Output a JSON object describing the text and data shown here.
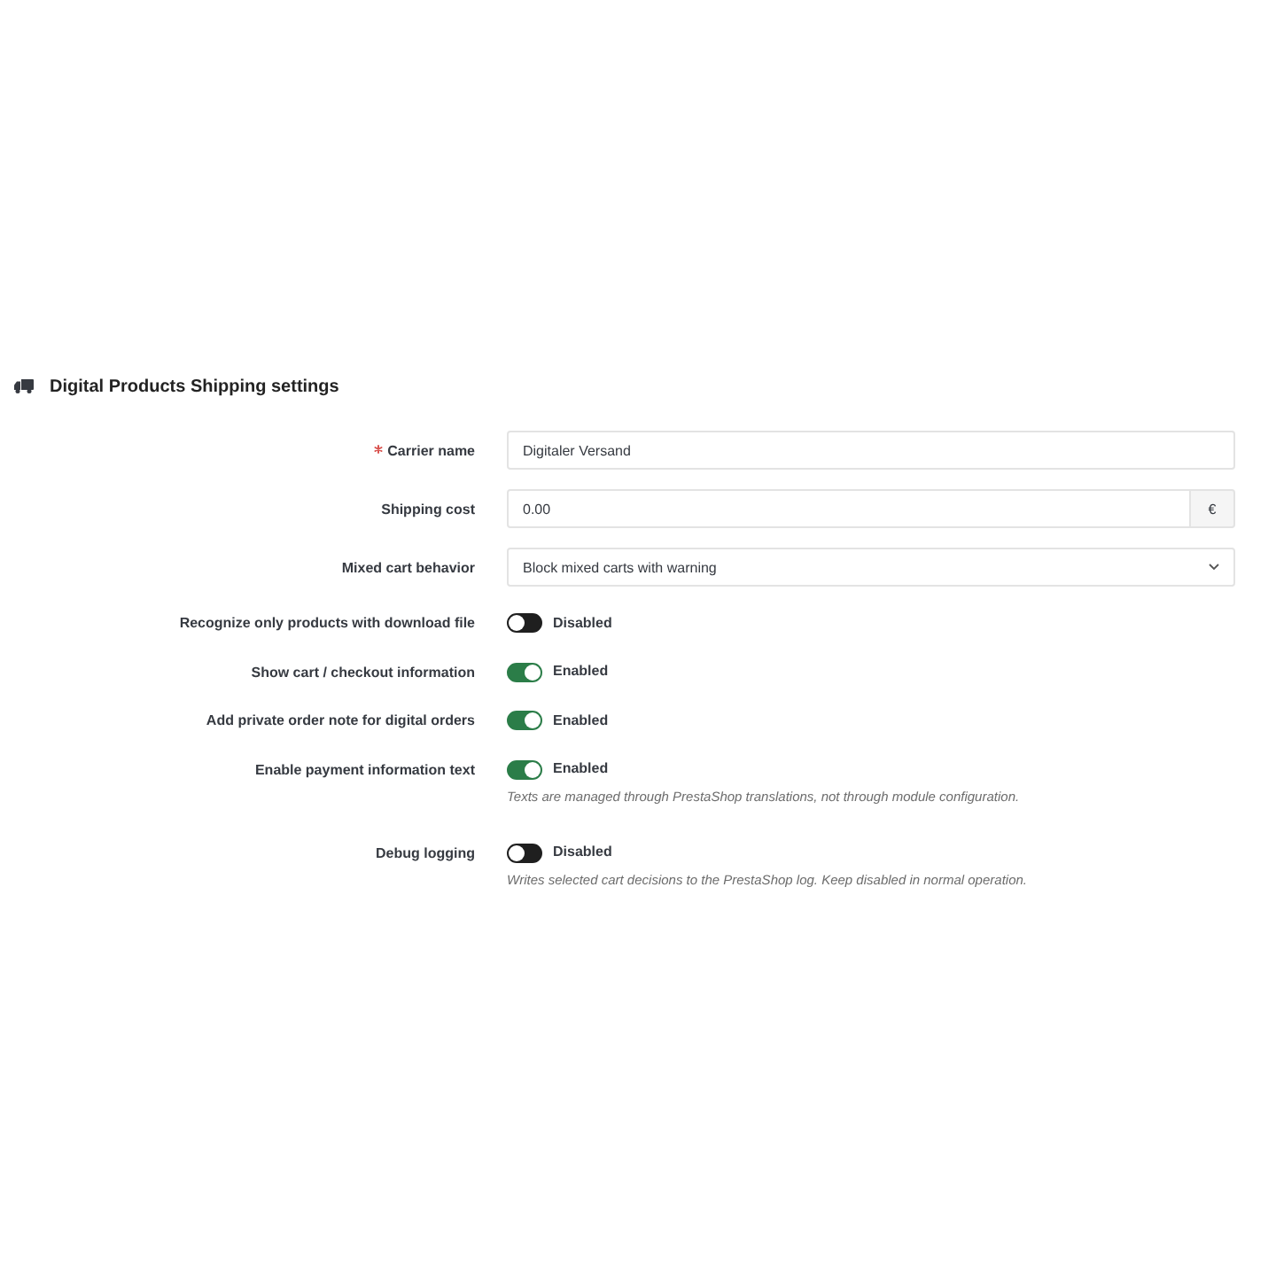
{
  "panel": {
    "title": "Digital Products Shipping settings"
  },
  "fields": [
    {
      "kind": "text",
      "label": "Carrier name",
      "required": true,
      "value": "Digitaler Versand"
    },
    {
      "kind": "input-group",
      "label": "Shipping cost",
      "required": false,
      "value": "0.00",
      "suffix": "€"
    },
    {
      "kind": "select",
      "label": "Mixed cart behavior",
      "required": false,
      "value": "Block mixed carts with warning"
    },
    {
      "kind": "switch",
      "label": "Recognize only products with download file",
      "on": false,
      "state_label": "Disabled"
    },
    {
      "kind": "switch",
      "label": "Show cart / checkout information",
      "on": true,
      "state_label": "Enabled"
    },
    {
      "kind": "switch",
      "label": "Add private order note for digital orders",
      "on": true,
      "state_label": "Enabled"
    },
    {
      "kind": "switch",
      "label": "Enable payment information text",
      "on": true,
      "state_label": "Enabled",
      "help": "Texts are managed through PrestaShop translations, not through module configuration."
    },
    {
      "kind": "switch",
      "label": "Debug logging",
      "on": false,
      "state_label": "Disabled",
      "help": "Writes selected cart decisions to the PrestaShop log. Keep disabled in normal operation."
    }
  ]
}
